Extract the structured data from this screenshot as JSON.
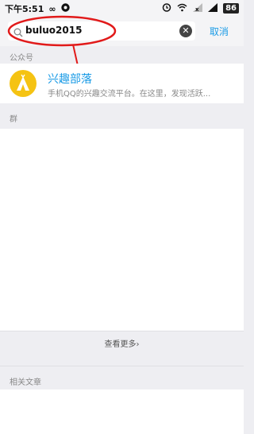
{
  "status": {
    "time": "下午5:51",
    "battery": "86"
  },
  "search": {
    "query": "buluo2015",
    "cancel_label": "取消"
  },
  "sections": {
    "public_accounts": "公众号",
    "groups": "群",
    "related_articles": "相关文章"
  },
  "account": {
    "name": "兴趣部落",
    "description": "手机QQ的兴趣交流平台。在这里，发现活跃..."
  },
  "groups_more_label": "查看更多›",
  "colors": {
    "accent": "#1a9be6",
    "annotation": "#e11a1a",
    "avatar": "#f5c313"
  }
}
